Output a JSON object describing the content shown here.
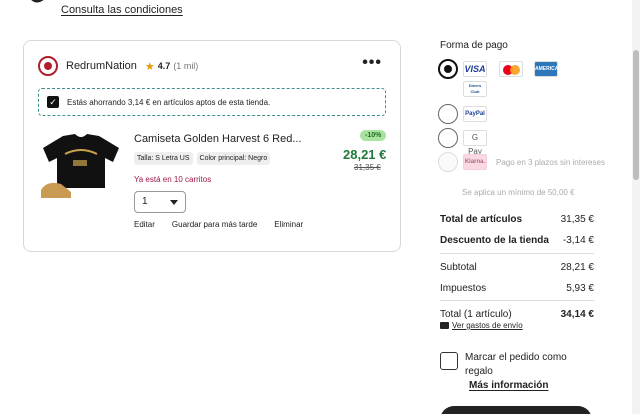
{
  "header": {
    "terms_link": "Consulta las condiciones"
  },
  "shop": {
    "name": "RedrumNation",
    "rating": "4.7",
    "reviews": "(1 mil)",
    "savings_text": "Estás ahorrando 3,14 € en artículos aptos de esta tienda."
  },
  "item": {
    "title": "Camiseta Golden Harvest 6 Red...",
    "chips": [
      "Talla: S Letra US",
      "Color principal: Negro"
    ],
    "discount_badge": "-10%",
    "price": "28,21 €",
    "old_price": "31,35 €",
    "in_carts": "Ya está en 10 carritos",
    "quantity": "1",
    "actions": {
      "edit": "Editar",
      "save_later": "Guardar para más tarde",
      "remove": "Eliminar"
    }
  },
  "payment": {
    "title": "Forma de pago",
    "logos": {
      "visa": "VISA",
      "amex": "AMERICAN EXPRESS",
      "diners": "Diners Club",
      "paypal": "PayPal",
      "gpay": "G Pay",
      "klarna": "Klarna."
    },
    "klarna_text": "Pago en 3 plazos sin intereses",
    "min_note": "Se aplica un mínimo de 50,00 €"
  },
  "summary": {
    "items_total_label": "Total de artículos",
    "items_total_value": "31,35 €",
    "shop_discount_label": "Descuento de la tienda",
    "shop_discount_value": "-3,14 €",
    "subtotal_label": "Subtotal",
    "subtotal_value": "28,21 €",
    "taxes_label": "Impuestos",
    "taxes_value": "5,93 €",
    "total_label": "Total (1 artículo)",
    "total_value": "34,14 €",
    "shipping_link": "Ver gastos de envío"
  },
  "gift": {
    "label": "Marcar el pedido como regalo",
    "more_info": "Más información"
  }
}
